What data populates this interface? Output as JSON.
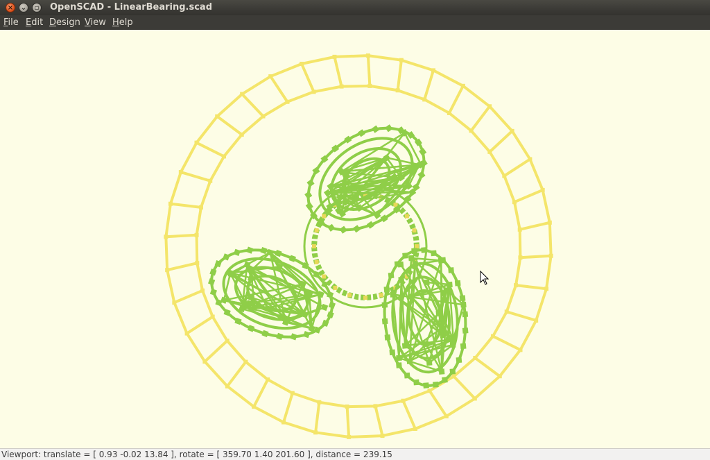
{
  "window": {
    "title": "OpenSCAD - LinearBearing.scad",
    "controls": {
      "close": "×",
      "minimize": "⌄",
      "maximize": "▫"
    }
  },
  "menu": {
    "file": {
      "mnemonic": "F",
      "rest": "ile"
    },
    "edit": {
      "mnemonic": "E",
      "rest": "dit"
    },
    "design": {
      "mnemonic": "D",
      "rest": "esign"
    },
    "view": {
      "mnemonic": "V",
      "rest": "iew"
    },
    "help": {
      "mnemonic": "H",
      "rest": "elp"
    }
  },
  "viewport": {
    "background": "#fdfde6",
    "outer_ring_color": "#f4e56a",
    "bearing_color": "#8fce48",
    "cursor": "arrow-cursor-icon"
  },
  "status": {
    "text": "Viewport: translate = [ 0.93 -0.02 13.84 ], rotate = [ 359.70 1.40 201.60 ], distance = 239.15"
  }
}
